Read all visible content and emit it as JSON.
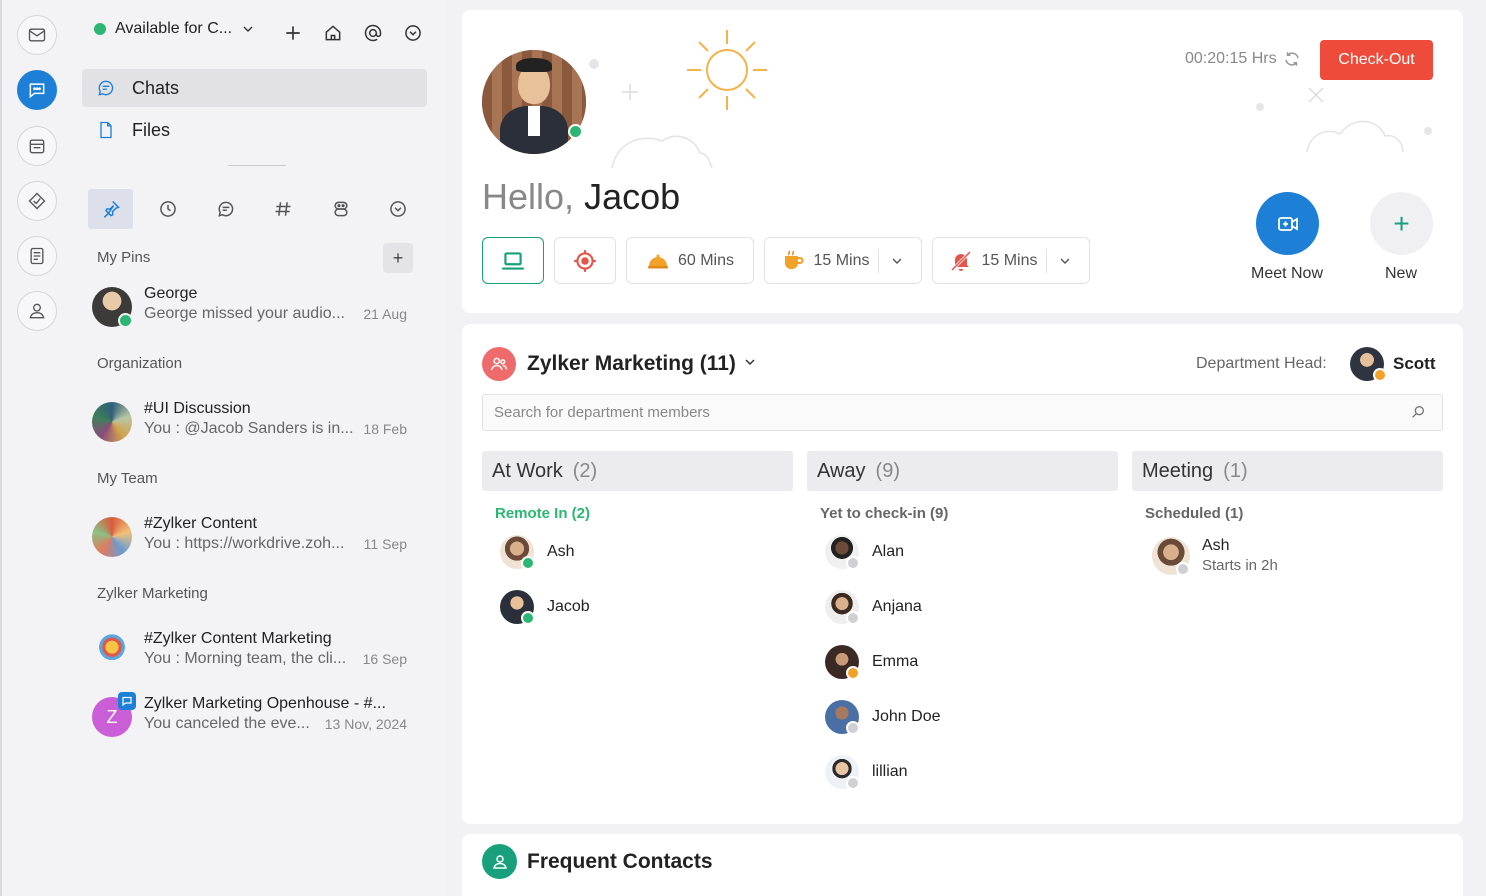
{
  "status": {
    "label": "Available for C...",
    "color": "#2bb673"
  },
  "nav": {
    "chats": "Chats",
    "files": "Files"
  },
  "sections": {
    "pins": "My Pins",
    "org": "Organization",
    "team": "My Team",
    "zylker": "Zylker Marketing"
  },
  "pin_add": "+",
  "chats": [
    {
      "name": "George",
      "msg": "George missed your audio...",
      "date": "21 Aug"
    },
    {
      "name": "#UI Discussion",
      "msg": "You : @Jacob Sanders  is in...",
      "date": "18 Feb"
    },
    {
      "name": "#Zylker Content",
      "msg": "You : https://workdrive.zoh...",
      "date": "11 Sep"
    },
    {
      "name": "#Zylker Content Marketing",
      "msg": "You : Morning team, the cli...",
      "date": "16 Sep"
    },
    {
      "name": "Zylker Marketing Openhouse - #...",
      "msg": "You canceled the eve...",
      "date": "13 Nov, 2024",
      "initial": "Z"
    }
  ],
  "hero": {
    "greeting": "Hello,",
    "name": "Jacob",
    "timer": "00:20:15 Hrs",
    "checkout": "Check-Out",
    "lunch": "60 Mins",
    "coffee": "15 Mins",
    "dnd": "15 Mins",
    "meet_now": "Meet Now",
    "new": "New",
    "new_symbol": "+"
  },
  "dept": {
    "title": "Zylker Marketing (11)",
    "head_label": "Department Head:",
    "head_name": "Scott",
    "search_placeholder": "Search for department members",
    "columns": [
      {
        "title": "At Work",
        "count": "(2)",
        "sub": "Remote In (2)",
        "members": [
          {
            "name": "Ash",
            "status": "#2bb673"
          },
          {
            "name": "Jacob",
            "status": "#2bb673"
          }
        ]
      },
      {
        "title": "Away",
        "count": "(9)",
        "sub": "Yet to check-in (9)",
        "members": [
          {
            "name": "Alan",
            "status": "#cfcfd4"
          },
          {
            "name": "Anjana",
            "status": "#cfcfd4"
          },
          {
            "name": "Emma",
            "status": "#f2a227"
          },
          {
            "name": "John Doe",
            "status": "#cfcfd4"
          },
          {
            "name": "lillian",
            "status": "#cfcfd4"
          }
        ]
      },
      {
        "title": "Meeting",
        "count": "(1)",
        "sub": "Scheduled (1)",
        "members": [
          {
            "name": "Ash",
            "detail": "Starts in 2h",
            "status": "#cfcfd4"
          }
        ]
      }
    ]
  },
  "frequent": {
    "title": "Frequent Contacts"
  },
  "colors": {
    "accent": "#1d7fd6",
    "checkout": "#ef4b3b",
    "green": "#17a07b"
  }
}
